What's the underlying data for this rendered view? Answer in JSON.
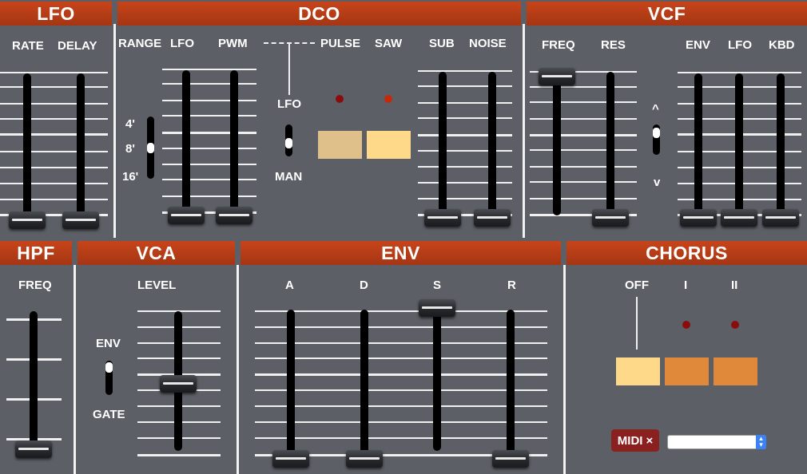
{
  "sections": {
    "lfo": "LFO",
    "dco": "DCO",
    "vcf": "VCF",
    "hpf": "HPF",
    "vca": "VCA",
    "env": "ENV",
    "chorus": "CHORUS"
  },
  "lfo": {
    "rate": "RATE",
    "delay": "DELAY"
  },
  "dco": {
    "range": "RANGE",
    "lfo": "LFO",
    "pwm": "PWM",
    "pulse": "PULSE",
    "saw": "SAW",
    "sub": "SUB",
    "noise": "NOISE",
    "range_values": [
      "4'",
      "8'",
      "16'"
    ],
    "pwm_mode_lfo": "LFO",
    "pwm_mode_man": "MAN"
  },
  "vcf": {
    "freq": "FREQ",
    "res": "RES",
    "env": "ENV",
    "lfo": "LFO",
    "kbd": "KBD",
    "pol_up": "^",
    "pol_down": "v"
  },
  "hpf": {
    "freq": "FREQ"
  },
  "vca": {
    "level": "LEVEL",
    "env": "ENV",
    "gate": "GATE"
  },
  "env": {
    "a": "A",
    "d": "D",
    "s": "S",
    "r": "R"
  },
  "chorus": {
    "off": "OFF",
    "i": "I",
    "ii": "II"
  },
  "midi": {
    "label": "MIDI",
    "close": "×",
    "device_value": ""
  },
  "colors": {
    "panel": "#5c6066",
    "header": "#b23c16",
    "button_light": "#fed98a",
    "button_tan": "#e0c08a",
    "button_orange": "#e0893a",
    "led_dark": "#8a0c0c",
    "led_red": "#c42a0a",
    "midi_badge": "#8a2020"
  },
  "sliders": {
    "lfo_rate": 0.0,
    "lfo_delay": 0.0,
    "dco_lfo": 0.0,
    "dco_pwm": 0.0,
    "dco_sub": 0.0,
    "dco_noise": 0.0,
    "vcf_freq": 1.0,
    "vcf_res": 0.0,
    "vcf_env": 0.0,
    "vcf_lfo": 0.0,
    "vcf_kbd": 0.0,
    "hpf_freq": 0.0,
    "vca_level": 0.5,
    "env_a": 0.0,
    "env_d": 0.0,
    "env_s": 1.0,
    "env_r": 0.0
  },
  "switches": {
    "dco_range": "8'",
    "dco_pwm_mode": "LFO",
    "vcf_polarity": "^",
    "vca_mode": "ENV"
  },
  "chorus_state": "OFF"
}
